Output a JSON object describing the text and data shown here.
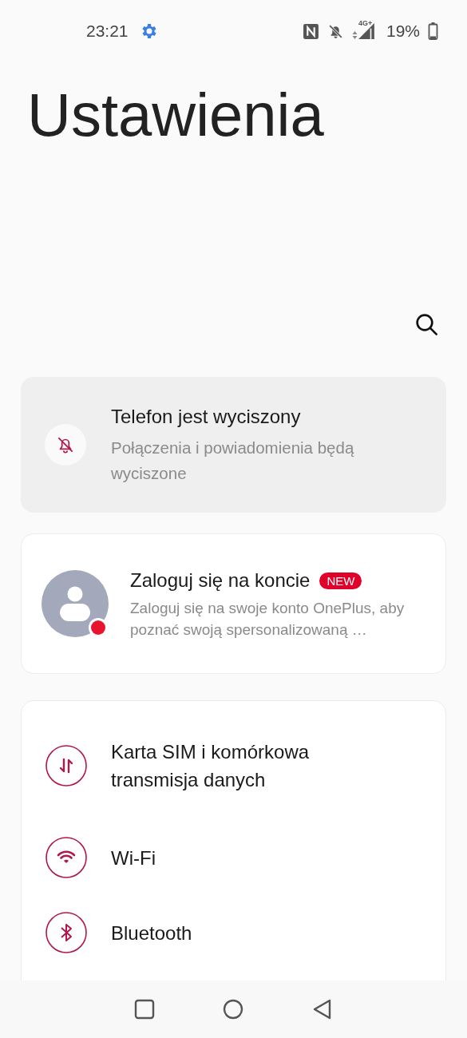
{
  "status_bar": {
    "time": "23:21",
    "battery": "19%",
    "network": "4G+"
  },
  "title": "Ustawienia",
  "silent_card": {
    "title": "Telefon jest wyciszony",
    "subtitle": "Połączenia i powiadomienia będą wyciszone"
  },
  "account_card": {
    "title": "Zaloguj się na koncie",
    "badge": "NEW",
    "subtitle": "Zaloguj się na swoje konto OnePlus, aby poznać swoją spersonalizowaną …"
  },
  "settings": [
    {
      "kind": "data",
      "label": "Karta SIM i komórkowa transmisja danych"
    },
    {
      "kind": "wifi",
      "label": "Wi-Fi"
    },
    {
      "kind": "bluetooth",
      "label": "Bluetooth"
    }
  ]
}
